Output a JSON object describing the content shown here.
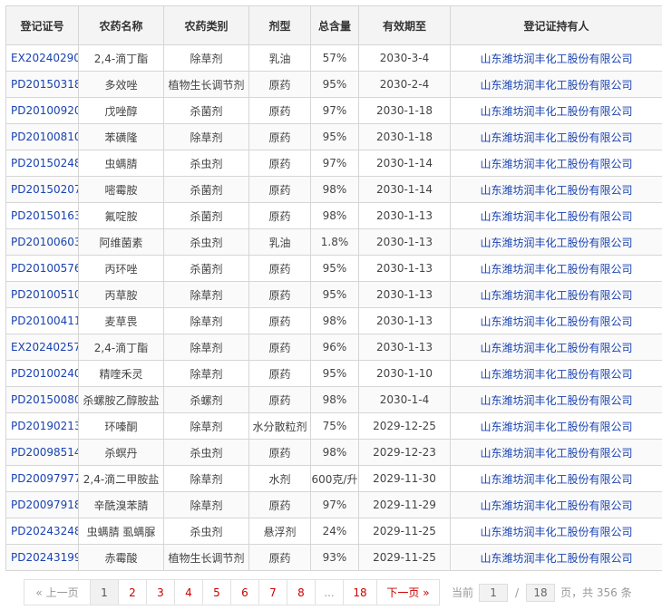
{
  "table": {
    "headers": [
      "登记证号",
      "农药名称",
      "农药类别",
      "剂型",
      "总含量",
      "有效期至",
      "登记证持有人"
    ],
    "rows": [
      [
        "EX20240290",
        "2,4-滴丁酯",
        "除草剂",
        "乳油",
        "57%",
        "2030-3-4",
        "山东潍坊润丰化工股份有限公司"
      ],
      [
        "PD20150318",
        "多效唑",
        "植物生长调节剂",
        "原药",
        "95%",
        "2030-2-4",
        "山东潍坊润丰化工股份有限公司"
      ],
      [
        "PD20100920",
        "戊唑醇",
        "杀菌剂",
        "原药",
        "97%",
        "2030-1-18",
        "山东潍坊润丰化工股份有限公司"
      ],
      [
        "PD20100810",
        "苯磺隆",
        "除草剂",
        "原药",
        "95%",
        "2030-1-18",
        "山东潍坊润丰化工股份有限公司"
      ],
      [
        "PD20150248",
        "虫螨腈",
        "杀虫剂",
        "原药",
        "97%",
        "2030-1-14",
        "山东潍坊润丰化工股份有限公司"
      ],
      [
        "PD20150207",
        "嘧霉胺",
        "杀菌剂",
        "原药",
        "98%",
        "2030-1-14",
        "山东潍坊润丰化工股份有限公司"
      ],
      [
        "PD20150163",
        "氟啶胺",
        "杀菌剂",
        "原药",
        "98%",
        "2030-1-13",
        "山东潍坊润丰化工股份有限公司"
      ],
      [
        "PD20100603",
        "阿维菌素",
        "杀虫剂",
        "乳油",
        "1.8%",
        "2030-1-13",
        "山东潍坊润丰化工股份有限公司"
      ],
      [
        "PD20100576",
        "丙环唑",
        "杀菌剂",
        "原药",
        "95%",
        "2030-1-13",
        "山东潍坊润丰化工股份有限公司"
      ],
      [
        "PD20100510",
        "丙草胺",
        "除草剂",
        "原药",
        "95%",
        "2030-1-13",
        "山东潍坊润丰化工股份有限公司"
      ],
      [
        "PD20100411",
        "麦草畏",
        "除草剂",
        "原药",
        "98%",
        "2030-1-13",
        "山东潍坊润丰化工股份有限公司"
      ],
      [
        "EX20240257",
        "2,4-滴丁酯",
        "除草剂",
        "原药",
        "96%",
        "2030-1-13",
        "山东潍坊润丰化工股份有限公司"
      ],
      [
        "PD20100240",
        "精喹禾灵",
        "除草剂",
        "原药",
        "95%",
        "2030-1-10",
        "山东潍坊润丰化工股份有限公司"
      ],
      [
        "PD20150080",
        "杀螺胺乙醇胺盐",
        "杀螺剂",
        "原药",
        "98%",
        "2030-1-4",
        "山东潍坊润丰化工股份有限公司"
      ],
      [
        "PD20190213",
        "环嗪酮",
        "除草剂",
        "水分散粒剂",
        "75%",
        "2029-12-25",
        "山东潍坊润丰化工股份有限公司"
      ],
      [
        "PD20098514",
        "杀螟丹",
        "杀虫剂",
        "原药",
        "98%",
        "2029-12-23",
        "山东潍坊润丰化工股份有限公司"
      ],
      [
        "PD20097977",
        "2,4-滴二甲胺盐",
        "除草剂",
        "水剂",
        "600克/升",
        "2029-11-30",
        "山东潍坊润丰化工股份有限公司"
      ],
      [
        "PD20097918",
        "辛酰溴苯腈",
        "除草剂",
        "原药",
        "97%",
        "2029-11-29",
        "山东潍坊润丰化工股份有限公司"
      ],
      [
        "PD20243248",
        "虫螨腈 虱螨脲",
        "杀虫剂",
        "悬浮剂",
        "24%",
        "2029-11-25",
        "山东潍坊润丰化工股份有限公司"
      ],
      [
        "PD20243199",
        "赤霉酸",
        "植物生长调节剂",
        "原药",
        "93%",
        "2029-11-25",
        "山东潍坊润丰化工股份有限公司"
      ]
    ]
  },
  "pagination": {
    "prev_label": "« 上一页",
    "pages": [
      "1",
      "2",
      "3",
      "4",
      "5",
      "6",
      "7",
      "8"
    ],
    "active_page": "1",
    "ellipsis": "...",
    "last_page": "18",
    "next_label": "下一页 »",
    "current_prefix": "当前",
    "current_value": "1",
    "separator": "/",
    "total_pages": "18",
    "total_suffix": "页，共 356 条"
  },
  "colors": {
    "link": "#1a43b0",
    "page_link": "#cc0000",
    "header_bg": "#f4f4f4",
    "border": "#d6d6d6"
  }
}
